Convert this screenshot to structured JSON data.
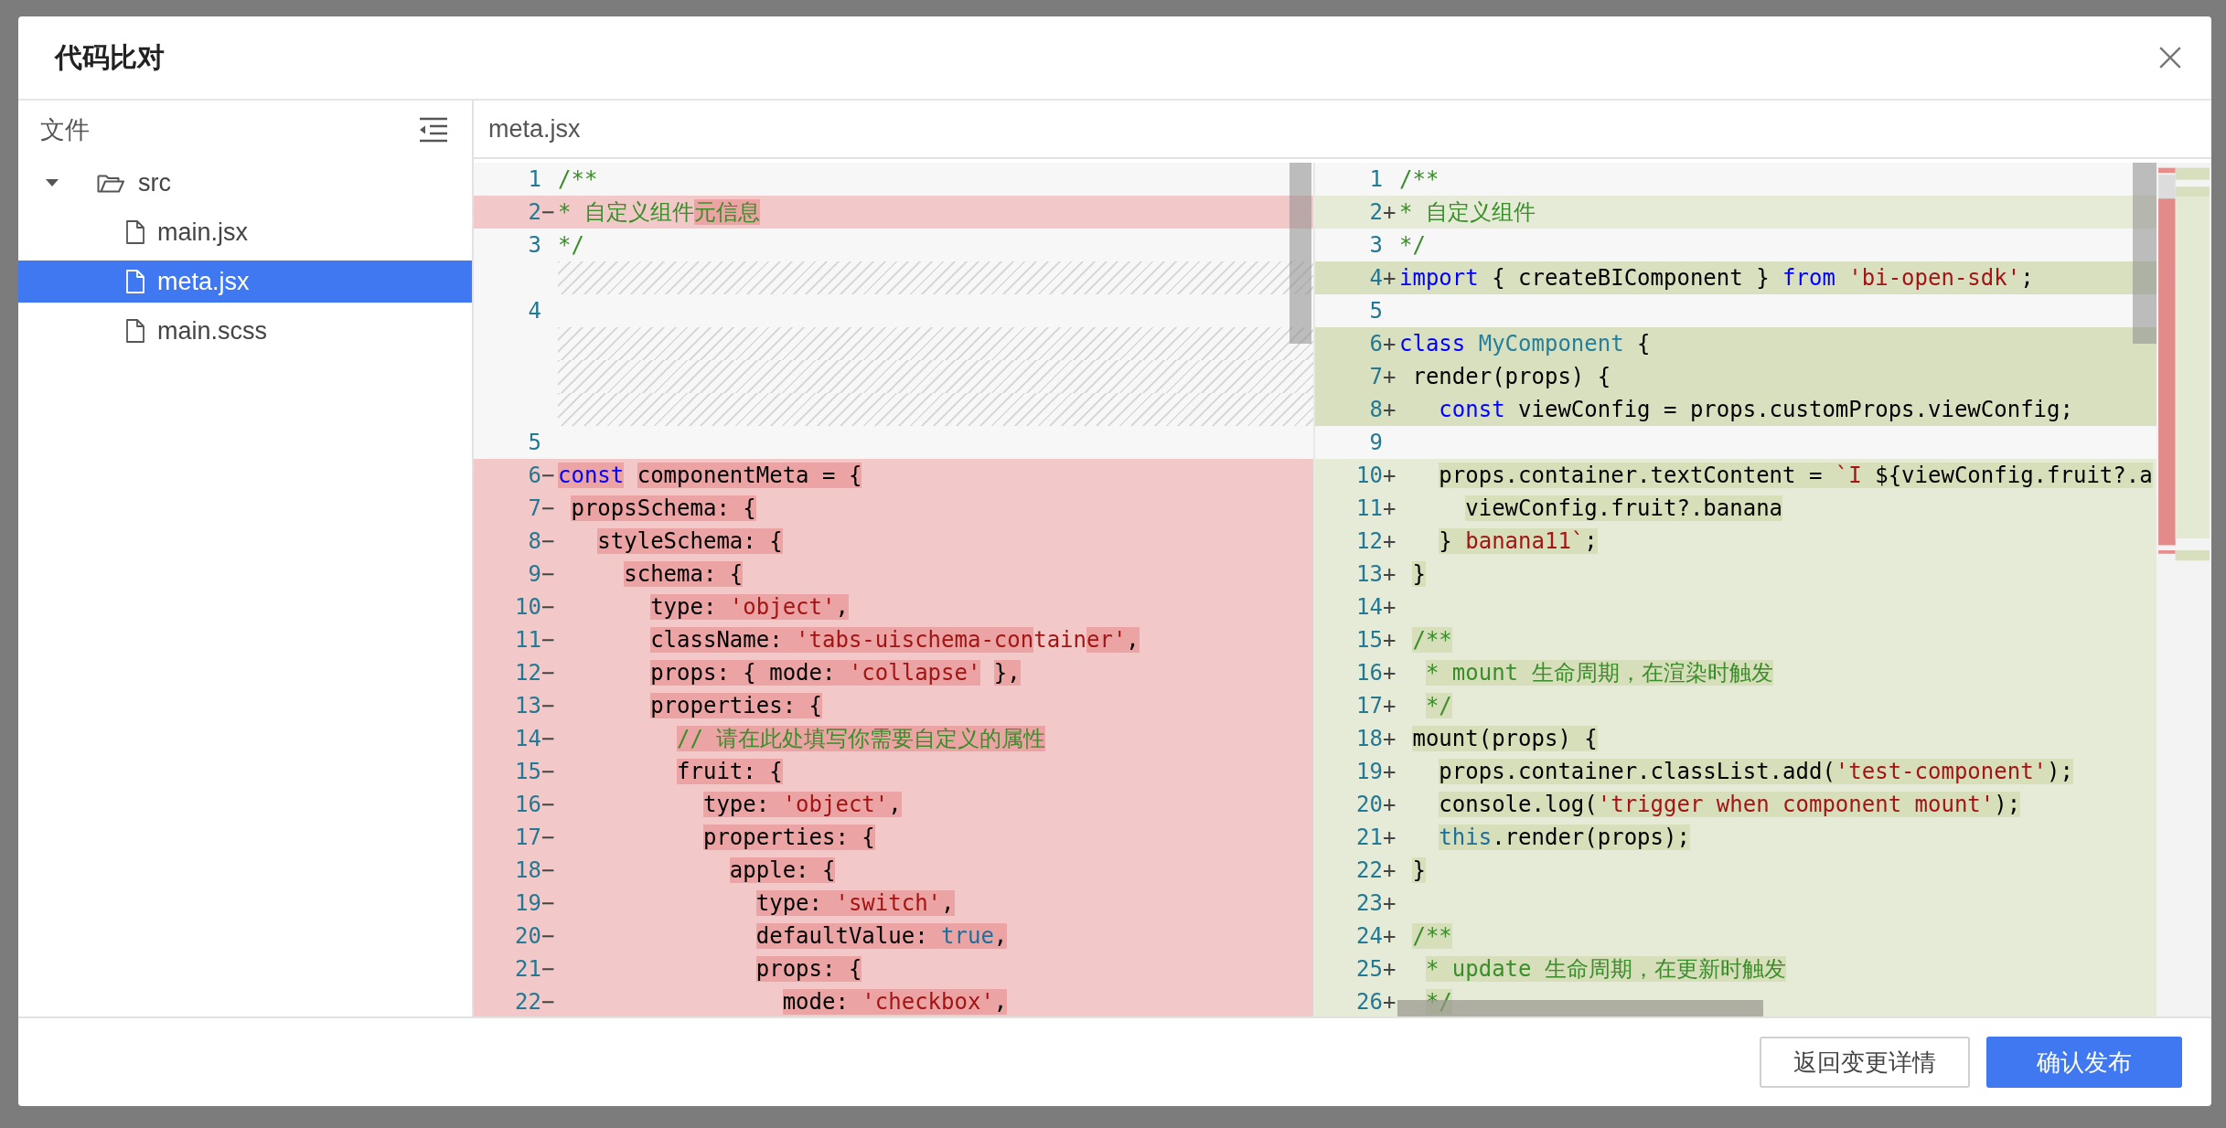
{
  "dialog": {
    "title": "代码比对"
  },
  "file_tree": {
    "header": "文件",
    "items": [
      {
        "label": "src",
        "kind": "folder",
        "expanded": true,
        "selected": false,
        "children": [
          {
            "label": "main.jsx",
            "kind": "file",
            "selected": false
          },
          {
            "label": "meta.jsx",
            "kind": "file",
            "selected": true
          },
          {
            "label": "main.scss",
            "kind": "file",
            "selected": false
          }
        ]
      }
    ]
  },
  "diff": {
    "file_name": "meta.jsx",
    "left": {
      "rows": [
        {
          "kind": "context",
          "number": "1",
          "segments": [
            {
              "text": "/**",
              "kind": "comment",
              "changed": false
            }
          ]
        },
        {
          "kind": "removed",
          "number": "2",
          "marker": "−",
          "segments": [
            {
              "text": "* 自定义组件",
              "kind": "comment",
              "changed": false
            },
            {
              "text": "元信息",
              "kind": "comment",
              "changed": true
            }
          ]
        },
        {
          "kind": "context",
          "number": "3",
          "segments": [
            {
              "text": "*/",
              "kind": "comment",
              "changed": false
            }
          ]
        },
        {
          "kind": "filler"
        },
        {
          "kind": "context",
          "number": "4"
        },
        {
          "kind": "filler"
        },
        {
          "kind": "filler"
        },
        {
          "kind": "filler"
        },
        {
          "kind": "context",
          "number": "5"
        },
        {
          "kind": "removed",
          "number": "6",
          "marker": "−",
          "segments": [
            {
              "text": "const",
              "kind": "keyword",
              "changed": true
            },
            {
              "text": " componentMeta = {",
              "kind": "plain",
              "changed": true
            }
          ]
        },
        {
          "kind": "removed",
          "number": "7",
          "marker": "−",
          "segments": [
            {
              "text": " propsSchema: {",
              "kind": "plain",
              "changed": true
            }
          ]
        },
        {
          "kind": "removed",
          "number": "8",
          "marker": "−",
          "segments": [
            {
              "text": "   styleSchema: {",
              "kind": "plain",
              "changed": true
            }
          ]
        },
        {
          "kind": "removed",
          "number": "9",
          "marker": "−",
          "segments": [
            {
              "text": "     schema: {",
              "kind": "plain",
              "changed": true
            }
          ]
        },
        {
          "kind": "removed",
          "number": "10",
          "marker": "−",
          "segments": [
            {
              "text": "       type: ",
              "kind": "plain",
              "changed": true
            },
            {
              "text": "'object'",
              "kind": "string",
              "changed": true
            },
            {
              "text": ",",
              "kind": "plain",
              "changed": true
            }
          ]
        },
        {
          "kind": "removed",
          "number": "11",
          "marker": "−",
          "segments": [
            {
              "text": "       className: ",
              "kind": "plain",
              "changed": true
            },
            {
              "text": "'tabs-uischema-con",
              "kind": "string",
              "changed": true
            },
            {
              "text": "tain",
              "kind": "string",
              "changed": false
            },
            {
              "text": "er'",
              "kind": "string",
              "changed": true
            },
            {
              "text": ",",
              "kind": "plain",
              "changed": true
            }
          ]
        },
        {
          "kind": "removed",
          "number": "12",
          "marker": "−",
          "segments": [
            {
              "text": "       props: { mode: ",
              "kind": "plain",
              "changed": true
            },
            {
              "text": "'collapse'",
              "kind": "string",
              "changed": true
            },
            {
              "text": " },",
              "kind": "plain",
              "changed": true
            }
          ]
        },
        {
          "kind": "removed",
          "number": "13",
          "marker": "−",
          "segments": [
            {
              "text": "       properties: {",
              "kind": "plain",
              "changed": true
            }
          ]
        },
        {
          "kind": "removed",
          "number": "14",
          "marker": "−",
          "segments": [
            {
              "text": "         // 请在此处填写你需要自定义的属性",
              "kind": "comment",
              "changed": true
            }
          ]
        },
        {
          "kind": "removed",
          "number": "15",
          "marker": "−",
          "segments": [
            {
              "text": "         fruit: {",
              "kind": "plain",
              "changed": true
            }
          ]
        },
        {
          "kind": "removed",
          "number": "16",
          "marker": "−",
          "segments": [
            {
              "text": "           type: ",
              "kind": "plain",
              "changed": true
            },
            {
              "text": "'object'",
              "kind": "string",
              "changed": true
            },
            {
              "text": ",",
              "kind": "plain",
              "changed": true
            }
          ]
        },
        {
          "kind": "removed",
          "number": "17",
          "marker": "−",
          "segments": [
            {
              "text": "           properties: {",
              "kind": "plain",
              "changed": true
            }
          ]
        },
        {
          "kind": "removed",
          "number": "18",
          "marker": "−",
          "segments": [
            {
              "text": "             apple: {",
              "kind": "plain",
              "changed": true
            }
          ]
        },
        {
          "kind": "removed",
          "number": "19",
          "marker": "−",
          "segments": [
            {
              "text": "               type: ",
              "kind": "plain",
              "changed": true
            },
            {
              "text": "'switch'",
              "kind": "string",
              "changed": true
            },
            {
              "text": ",",
              "kind": "plain",
              "changed": true
            }
          ]
        },
        {
          "kind": "removed",
          "number": "20",
          "marker": "−",
          "segments": [
            {
              "text": "               defaultValue: ",
              "kind": "plain",
              "changed": true
            },
            {
              "text": "true",
              "kind": "constant",
              "changed": true
            },
            {
              "text": ",",
              "kind": "plain",
              "changed": true
            }
          ]
        },
        {
          "kind": "removed",
          "number": "21",
          "marker": "−",
          "segments": [
            {
              "text": "               props: {",
              "kind": "plain",
              "changed": true
            }
          ]
        },
        {
          "kind": "removed",
          "number": "22",
          "marker": "−",
          "segments": [
            {
              "text": "                 mode: ",
              "kind": "plain",
              "changed": true
            },
            {
              "text": "'checkbox'",
              "kind": "string",
              "changed": true
            },
            {
              "text": ",",
              "kind": "plain",
              "changed": true
            }
          ]
        }
      ]
    },
    "right": {
      "rows": [
        {
          "kind": "context",
          "number": "1",
          "segments": [
            {
              "text": "/**",
              "kind": "comment",
              "changed": false
            }
          ]
        },
        {
          "kind": "added",
          "number": "2",
          "marker": "+",
          "segments": [
            {
              "text": "* 自定义组件",
              "kind": "comment",
              "changed": false
            }
          ]
        },
        {
          "kind": "context",
          "number": "3",
          "segments": [
            {
              "text": "*/",
              "kind": "comment",
              "changed": false
            }
          ]
        },
        {
          "kind": "added-strong",
          "number": "4",
          "marker": "+",
          "segments": [
            {
              "text": "import",
              "kind": "keyword",
              "changed": false
            },
            {
              "text": " { createBIComponent } ",
              "kind": "plain",
              "changed": false
            },
            {
              "text": "from",
              "kind": "keyword",
              "changed": false
            },
            {
              "text": " 'bi-open-sdk'",
              "kind": "string",
              "changed": false
            },
            {
              "text": ";",
              "kind": "plain",
              "changed": false
            }
          ]
        },
        {
          "kind": "context",
          "number": "5"
        },
        {
          "kind": "added-strong",
          "number": "6",
          "marker": "+",
          "segments": [
            {
              "text": "class",
              "kind": "keyword",
              "changed": false
            },
            {
              "text": " MyComponent",
              "kind": "type",
              "changed": false
            },
            {
              "text": " {",
              "kind": "plain",
              "changed": false
            }
          ]
        },
        {
          "kind": "added-strong",
          "number": "7",
          "marker": "+",
          "segments": [
            {
              "text": " render(props) {",
              "kind": "plain",
              "changed": false
            }
          ]
        },
        {
          "kind": "added-strong",
          "number": "8",
          "marker": "+",
          "segments": [
            {
              "text": "   const",
              "kind": "keyword",
              "changed": false
            },
            {
              "text": " viewConfig = props.customProps.viewConfig;",
              "kind": "plain",
              "changed": false
            }
          ]
        },
        {
          "kind": "context",
          "number": "9"
        },
        {
          "kind": "added",
          "number": "10",
          "marker": "+",
          "segments": [
            {
              "text": "   props.container.textContent = ",
              "kind": "plain",
              "changed": true
            },
            {
              "text": "`I ",
              "kind": "string",
              "changed": true
            },
            {
              "text": "${viewConfig.fruit?.a",
              "kind": "plain",
              "changed": true
            }
          ]
        },
        {
          "kind": "added",
          "number": "11",
          "marker": "+",
          "segments": [
            {
              "text": "     viewConfig.fruit?.banana",
              "kind": "plain",
              "changed": true
            }
          ]
        },
        {
          "kind": "added",
          "number": "12",
          "marker": "+",
          "segments": [
            {
              "text": "   } ",
              "kind": "plain",
              "changed": true
            },
            {
              "text": "banana11`",
              "kind": "string",
              "changed": true
            },
            {
              "text": ";",
              "kind": "plain",
              "changed": true
            }
          ]
        },
        {
          "kind": "added",
          "number": "13",
          "marker": "+",
          "segments": [
            {
              "text": " }",
              "kind": "plain",
              "changed": true
            }
          ]
        },
        {
          "kind": "added",
          "number": "14",
          "marker": "+"
        },
        {
          "kind": "added",
          "number": "15",
          "marker": "+",
          "segments": [
            {
              "text": " /**",
              "kind": "comment",
              "changed": true
            }
          ]
        },
        {
          "kind": "added",
          "number": "16",
          "marker": "+",
          "segments": [
            {
              "text": "  * mount 生命周期，在渲染时触发",
              "kind": "comment",
              "changed": true
            }
          ]
        },
        {
          "kind": "added",
          "number": "17",
          "marker": "+",
          "segments": [
            {
              "text": "  */",
              "kind": "comment",
              "changed": true
            }
          ]
        },
        {
          "kind": "added",
          "number": "18",
          "marker": "+",
          "segments": [
            {
              "text": " mount(props) {",
              "kind": "plain",
              "changed": true
            }
          ]
        },
        {
          "kind": "added",
          "number": "19",
          "marker": "+",
          "segments": [
            {
              "text": "   props.container.classList.add(",
              "kind": "plain",
              "changed": true
            },
            {
              "text": "'test-component'",
              "kind": "string",
              "changed": true
            },
            {
              "text": ");",
              "kind": "plain",
              "changed": true
            }
          ]
        },
        {
          "kind": "added",
          "number": "20",
          "marker": "+",
          "segments": [
            {
              "text": "   console.log(",
              "kind": "plain",
              "changed": true
            },
            {
              "text": "'trigger when component mount'",
              "kind": "string",
              "changed": true
            },
            {
              "text": ");",
              "kind": "plain",
              "changed": true
            }
          ]
        },
        {
          "kind": "added",
          "number": "21",
          "marker": "+",
          "segments": [
            {
              "text": "   this",
              "kind": "constant",
              "changed": true
            },
            {
              "text": ".render(props);",
              "kind": "plain",
              "changed": true
            }
          ]
        },
        {
          "kind": "added",
          "number": "22",
          "marker": "+",
          "segments": [
            {
              "text": " }",
              "kind": "plain",
              "changed": true
            }
          ]
        },
        {
          "kind": "added",
          "number": "23",
          "marker": "+"
        },
        {
          "kind": "added",
          "number": "24",
          "marker": "+",
          "segments": [
            {
              "text": " /**",
              "kind": "comment",
              "changed": true
            }
          ]
        },
        {
          "kind": "added",
          "number": "25",
          "marker": "+",
          "segments": [
            {
              "text": "  * update 生命周期，在更新时触发",
              "kind": "comment",
              "changed": true
            }
          ]
        },
        {
          "kind": "added",
          "number": "26",
          "marker": "+",
          "segments": [
            {
              "text": "  */",
              "kind": "comment",
              "changed": true
            }
          ]
        }
      ]
    }
  },
  "footer": {
    "buttons": [
      {
        "label": "返回变更详情",
        "kind": "secondary"
      },
      {
        "label": "确认发布",
        "kind": "primary"
      }
    ]
  }
}
